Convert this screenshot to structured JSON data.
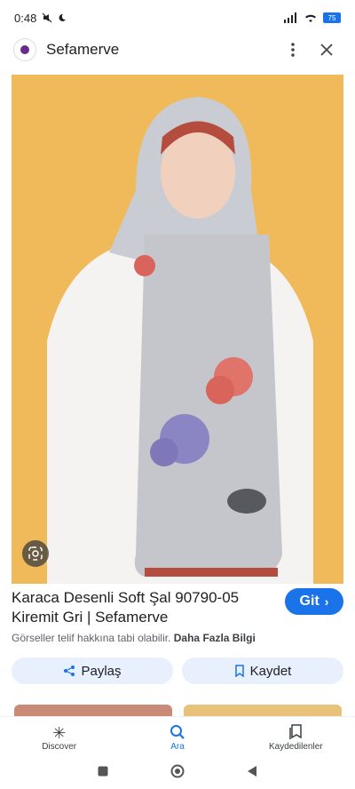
{
  "status": {
    "time": "0:48",
    "battery": "75"
  },
  "header": {
    "site_name": "Sefamerve",
    "more_icon": "more-vert-icon",
    "close_icon": "close-icon"
  },
  "hero": {
    "background": "#f0b95a"
  },
  "result": {
    "title": "Karaca Desenli Soft Şal 90790-05 Kiremit Gri | Sefamerve",
    "visit_label": "Git",
    "notice_text": "Görseller telif hakkına tabi olabilir.",
    "notice_link": "Daha Fazla Bilgi",
    "share_label": "Paylaş",
    "save_label": "Kaydet"
  },
  "bottom_nav": [
    {
      "label": "Discover",
      "icon": "asterisk-icon"
    },
    {
      "label": "Ara",
      "icon": "search-icon"
    },
    {
      "label": "Kaydedilenler",
      "icon": "bookmarks-icon"
    }
  ],
  "colors": {
    "accent": "#1a73e8",
    "chip_bg": "#e8f0fe"
  }
}
